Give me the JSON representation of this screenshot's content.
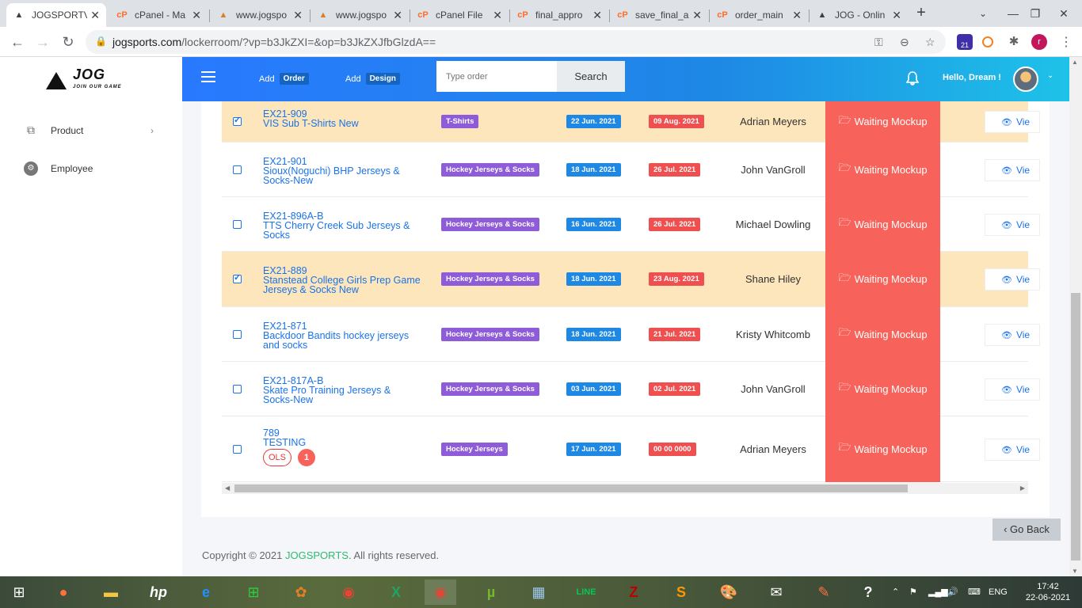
{
  "browser": {
    "tabs": [
      {
        "title": "JOGSPORTV",
        "icon": "jog-logo-icon",
        "active": true
      },
      {
        "title": "cPanel - Ma",
        "icon": "cpanel-icon"
      },
      {
        "title": "www.jogspo",
        "icon": "site-icon"
      },
      {
        "title": "www.jogspo",
        "icon": "site-icon"
      },
      {
        "title": "cPanel File",
        "icon": "cpanel-icon"
      },
      {
        "title": "final_appro",
        "icon": "cpanel-icon"
      },
      {
        "title": "save_final_a",
        "icon": "cpanel-icon"
      },
      {
        "title": "order_main",
        "icon": "cpanel-icon"
      },
      {
        "title": "JOG - Onlin",
        "icon": "jog-logo-icon"
      }
    ],
    "url_host": "jogsports.com",
    "url_path": "/lockerroom/?vp=b3JkZXI=&op=b3JkZXJfbGlzdA==",
    "ext_badge": "21",
    "profile_initial": "r"
  },
  "logo": {
    "word": "JOG",
    "tagline": "JOIN OUR GAME"
  },
  "sidebar": {
    "items": [
      {
        "label": "Product",
        "icon": "copy-icon"
      },
      {
        "label": "Employee",
        "icon": "user-cog-icon"
      }
    ]
  },
  "topnav": {
    "add_label_1": "Add",
    "add_pill_1": "Order",
    "add_label_2": "Add",
    "add_pill_2": "Design",
    "search_placeholder": "Type order",
    "search_button": "Search",
    "greeting": "Hello, Dream !"
  },
  "orders": [
    {
      "id": "EX21-909",
      "name": "VIS Sub T-Shirts New",
      "tag": "T-Shirts",
      "date1": "22 Jun. 2021",
      "date2": "09 Aug. 2021",
      "person": "Adrian Meyers",
      "status": "Waiting Mockup",
      "view": "Vie",
      "checked": true
    },
    {
      "id": "EX21-901",
      "name": "Sioux(Noguchi) BHP Jerseys & Socks-New",
      "tag": "Hockey Jerseys & Socks",
      "date1": "18 Jun. 2021",
      "date2": "26 Jul. 2021",
      "person": "John VanGroll",
      "status": "Waiting Mockup",
      "view": "Vie",
      "checked": false
    },
    {
      "id": "EX21-896A-B",
      "name": "TTS Cherry Creek Sub Jerseys & Socks",
      "tag": "Hockey Jerseys & Socks",
      "date1": "16 Jun. 2021",
      "date2": "26 Jul. 2021",
      "person": "Michael Dowling",
      "status": "Waiting Mockup",
      "view": "Vie",
      "checked": false
    },
    {
      "id": "EX21-889",
      "name": "Stanstead College Girls Prep Game Jerseys & Socks New",
      "tag": "Hockey Jerseys & Socks",
      "date1": "18 Jun. 2021",
      "date2": "23 Aug. 2021",
      "person": "Shane Hiley",
      "status": "Waiting Mockup",
      "view": "Vie",
      "checked": true
    },
    {
      "id": "EX21-871",
      "name": "Backdoor Bandits hockey jerseys and socks",
      "tag": "Hockey Jerseys & Socks",
      "date1": "18 Jun. 2021",
      "date2": "21 Jul. 2021",
      "person": "Kristy Whitcomb",
      "status": "Waiting Mockup",
      "view": "Vie",
      "checked": false
    },
    {
      "id": "EX21-817A-B",
      "name": "Skate Pro Training Jerseys & Socks-New",
      "tag": "Hockey Jerseys & Socks",
      "date1": "03 Jun. 2021",
      "date2": "02 Jul. 2021",
      "person": "John VanGroll",
      "status": "Waiting Mockup",
      "view": "Vie",
      "checked": false
    },
    {
      "id": "789",
      "name": "TESTING",
      "tag": "Hockey Jerseys",
      "date1": "17 Jun. 2021",
      "date2": "00 00 0000",
      "person": "Adrian Meyers",
      "status": "Waiting Mockup",
      "view": "Vie",
      "checked": false,
      "ols": "OLS",
      "badge": "1"
    }
  ],
  "footer": {
    "go_back": "‹ Go Back",
    "copy_prefix": "Copyright © 2021 ",
    "copy_brand": "JOGSPORTS",
    "copy_suffix": ". All rights reserved."
  },
  "taskbar": {
    "lang": "ENG",
    "time": "17:42",
    "date": "22-06-2021"
  },
  "colors": {
    "nav_gradient_start": "#2979ff",
    "nav_gradient_end": "#1ec2e8",
    "status_red": "#f7625a",
    "selected_row": "#fde6bb",
    "tag_purple": "#8e5cd9",
    "date_blue": "#1e88e5",
    "date_red": "#ef4f4f",
    "brand_green": "#2ebc6e"
  }
}
